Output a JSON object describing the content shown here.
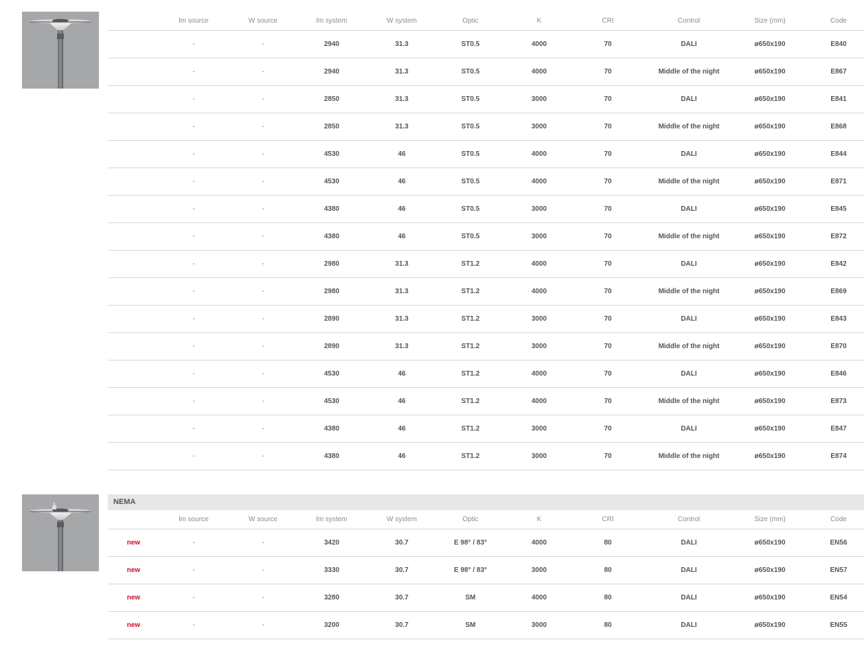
{
  "columns": [
    "lm source",
    "W source",
    "lm system",
    "W system",
    "Optic",
    "K",
    "CRI",
    "Control",
    "Size (mm)",
    "Code"
  ],
  "colors": {
    "new_badge": "#c8102e",
    "header_band": "#e7e7e7",
    "image_bg": "#a6a7a9"
  },
  "section1": {
    "rows": [
      [
        "-",
        "-",
        "2940",
        "31.3",
        "ST0.5",
        "4000",
        "70",
        "DALI",
        "ø650x190",
        "E840"
      ],
      [
        "-",
        "-",
        "2940",
        "31.3",
        "ST0.5",
        "4000",
        "70",
        "Middle of the night",
        "ø650x190",
        "E867"
      ],
      [
        "-",
        "-",
        "2850",
        "31.3",
        "ST0.5",
        "3000",
        "70",
        "DALI",
        "ø650x190",
        "E841"
      ],
      [
        "-",
        "-",
        "2850",
        "31.3",
        "ST0.5",
        "3000",
        "70",
        "Middle of the night",
        "ø650x190",
        "E868"
      ],
      [
        "-",
        "-",
        "4530",
        "46",
        "ST0.5",
        "4000",
        "70",
        "DALI",
        "ø650x190",
        "E844"
      ],
      [
        "-",
        "-",
        "4530",
        "46",
        "ST0.5",
        "4000",
        "70",
        "Middle of the night",
        "ø650x190",
        "E871"
      ],
      [
        "-",
        "-",
        "4380",
        "46",
        "ST0.5",
        "3000",
        "70",
        "DALI",
        "ø650x190",
        "E845"
      ],
      [
        "-",
        "-",
        "4380",
        "46",
        "ST0.5",
        "3000",
        "70",
        "Middle of the night",
        "ø650x190",
        "E872"
      ],
      [
        "-",
        "-",
        "2980",
        "31.3",
        "ST1.2",
        "4000",
        "70",
        "DALI",
        "ø650x190",
        "E842"
      ],
      [
        "-",
        "-",
        "2980",
        "31.3",
        "ST1.2",
        "4000",
        "70",
        "Middle of the night",
        "ø650x190",
        "E869"
      ],
      [
        "-",
        "-",
        "2890",
        "31.3",
        "ST1.2",
        "3000",
        "70",
        "DALI",
        "ø650x190",
        "E843"
      ],
      [
        "-",
        "-",
        "2890",
        "31.3",
        "ST1.2",
        "3000",
        "70",
        "Middle of the night",
        "ø650x190",
        "E870"
      ],
      [
        "-",
        "-",
        "4530",
        "46",
        "ST1.2",
        "4000",
        "70",
        "DALI",
        "ø650x190",
        "E846"
      ],
      [
        "-",
        "-",
        "4530",
        "46",
        "ST1.2",
        "4000",
        "70",
        "Middle of the night",
        "ø650x190",
        "E873"
      ],
      [
        "-",
        "-",
        "4380",
        "46",
        "ST1.2",
        "3000",
        "70",
        "DALI",
        "ø650x190",
        "E847"
      ],
      [
        "-",
        "-",
        "4380",
        "46",
        "ST1.2",
        "3000",
        "70",
        "Middle of the night",
        "ø650x190",
        "E874"
      ]
    ]
  },
  "section2": {
    "title": "NEMA",
    "badge": "new",
    "rows": [
      [
        "-",
        "-",
        "3420",
        "30.7",
        "E 98° / 83°",
        "4000",
        "80",
        "DALI",
        "ø650x190",
        "EN56"
      ],
      [
        "-",
        "-",
        "3330",
        "30.7",
        "E 98° / 83°",
        "3000",
        "80",
        "DALI",
        "ø650x190",
        "EN57"
      ],
      [
        "-",
        "-",
        "3280",
        "30.7",
        "SM",
        "4000",
        "80",
        "DALI",
        "ø650x190",
        "EN54"
      ],
      [
        "-",
        "-",
        "3200",
        "30.7",
        "SM",
        "3000",
        "80",
        "DALI",
        "ø650x190",
        "EN55"
      ]
    ]
  }
}
